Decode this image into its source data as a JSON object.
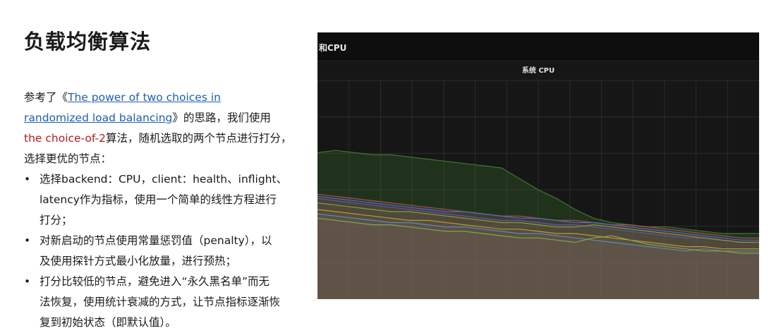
{
  "slide": {
    "title": "负载均衡算法"
  },
  "intro": {
    "prefix": "参考了《",
    "link_line1": "The power of two choices in",
    "link_line2": "randomized load balancing",
    "suffix": "》的思路，我们使用",
    "accent_text": "the choice-of-2",
    "after_accent": "算法，随机选取的两个节点进行打分，",
    "last_line": "选择更优的节点："
  },
  "bullets": {
    "marker": "•",
    "items": [
      {
        "lines": [
          "选择backend：CPU，client：health、inflight、",
          "latency作为指标，使用一个简单的线性方程进行",
          "打分；"
        ]
      },
      {
        "lines": [
          "对新启动的节点使用常量惩罚值（penalty），以",
          "及使用探针方式最小化放量，进行预热；"
        ]
      },
      {
        "lines": [
          "打分比较低的节点，避免进入“永久黑名单”而无",
          "法恢复，使用统计衰减的方式，让节点指标逐渐恢",
          "复到初始状态（即默认值）。"
        ]
      }
    ]
  },
  "panel": {
    "title": "和CPU"
  },
  "chart_data": {
    "type": "area",
    "title": "系统 CPU",
    "xlabel": "",
    "ylabel": "",
    "ylim": [
      0,
      1
    ],
    "grid": true,
    "legend": "none",
    "colors": {
      "background": "#161616",
      "grid": "#2c2c2c",
      "fill": "#7a655c"
    },
    "x": [
      0,
      1,
      2,
      3,
      4,
      5,
      6,
      7,
      8,
      9,
      10,
      11,
      12,
      13,
      14,
      15,
      16,
      17,
      18,
      19,
      20,
      21,
      22,
      23,
      24
    ],
    "series": [
      {
        "color": "#3e7d2e",
        "values": [
          0.67,
          0.68,
          0.67,
          0.66,
          0.66,
          0.65,
          0.64,
          0.63,
          0.62,
          0.61,
          0.6,
          0.55,
          0.5,
          0.46,
          0.41,
          0.37,
          0.35,
          0.34,
          0.33,
          0.33,
          0.32,
          0.31,
          0.3,
          0.3,
          0.3
        ]
      },
      {
        "color": "#b84a5a",
        "values": [
          0.48,
          0.47,
          0.46,
          0.45,
          0.44,
          0.43,
          0.42,
          0.41,
          0.4,
          0.39,
          0.38,
          0.38,
          0.37,
          0.36,
          0.36,
          0.35,
          0.34,
          0.34,
          0.33,
          0.32,
          0.31,
          0.3,
          0.29,
          0.28,
          0.28
        ]
      },
      {
        "color": "#4f6fd0",
        "values": [
          0.47,
          0.46,
          0.45,
          0.44,
          0.43,
          0.42,
          0.41,
          0.4,
          0.4,
          0.39,
          0.38,
          0.37,
          0.37,
          0.36,
          0.35,
          0.35,
          0.34,
          0.33,
          0.32,
          0.31,
          0.3,
          0.29,
          0.28,
          0.27,
          0.27
        ]
      },
      {
        "color": "#6a52b0",
        "values": [
          0.46,
          0.45,
          0.44,
          0.43,
          0.42,
          0.41,
          0.4,
          0.39,
          0.38,
          0.37,
          0.36,
          0.36,
          0.35,
          0.34,
          0.34,
          0.33,
          0.32,
          0.31,
          0.3,
          0.29,
          0.28,
          0.28,
          0.27,
          0.26,
          0.26
        ]
      },
      {
        "color": "#9a9a40",
        "values": [
          0.44,
          0.43,
          0.42,
          0.41,
          0.4,
          0.4,
          0.39,
          0.38,
          0.37,
          0.36,
          0.35,
          0.35,
          0.34,
          0.33,
          0.33,
          0.34,
          0.33,
          0.32,
          0.31,
          0.3,
          0.29,
          0.28,
          0.27,
          0.26,
          0.26
        ]
      },
      {
        "color": "#c99a30",
        "values": [
          0.41,
          0.4,
          0.39,
          0.38,
          0.37,
          0.36,
          0.36,
          0.35,
          0.34,
          0.33,
          0.32,
          0.32,
          0.31,
          0.3,
          0.3,
          0.29,
          0.28,
          0.27,
          0.26,
          0.25,
          0.24,
          0.24,
          0.23,
          0.23,
          0.23
        ]
      },
      {
        "color": "#5a90b8",
        "values": [
          0.39,
          0.38,
          0.37,
          0.36,
          0.35,
          0.35,
          0.34,
          0.33,
          0.33,
          0.32,
          0.31,
          0.3,
          0.3,
          0.29,
          0.28,
          0.27,
          0.26,
          0.25,
          0.24,
          0.23,
          0.22,
          0.23,
          0.22,
          0.22,
          0.22
        ]
      },
      {
        "color": "#88a850",
        "values": [
          0.37,
          0.36,
          0.35,
          0.34,
          0.34,
          0.33,
          0.32,
          0.31,
          0.31,
          0.3,
          0.29,
          0.28,
          0.28,
          0.27,
          0.26,
          0.28,
          0.29,
          0.27,
          0.25,
          0.24,
          0.23,
          0.22,
          0.22,
          0.21,
          0.21
        ]
      }
    ]
  }
}
